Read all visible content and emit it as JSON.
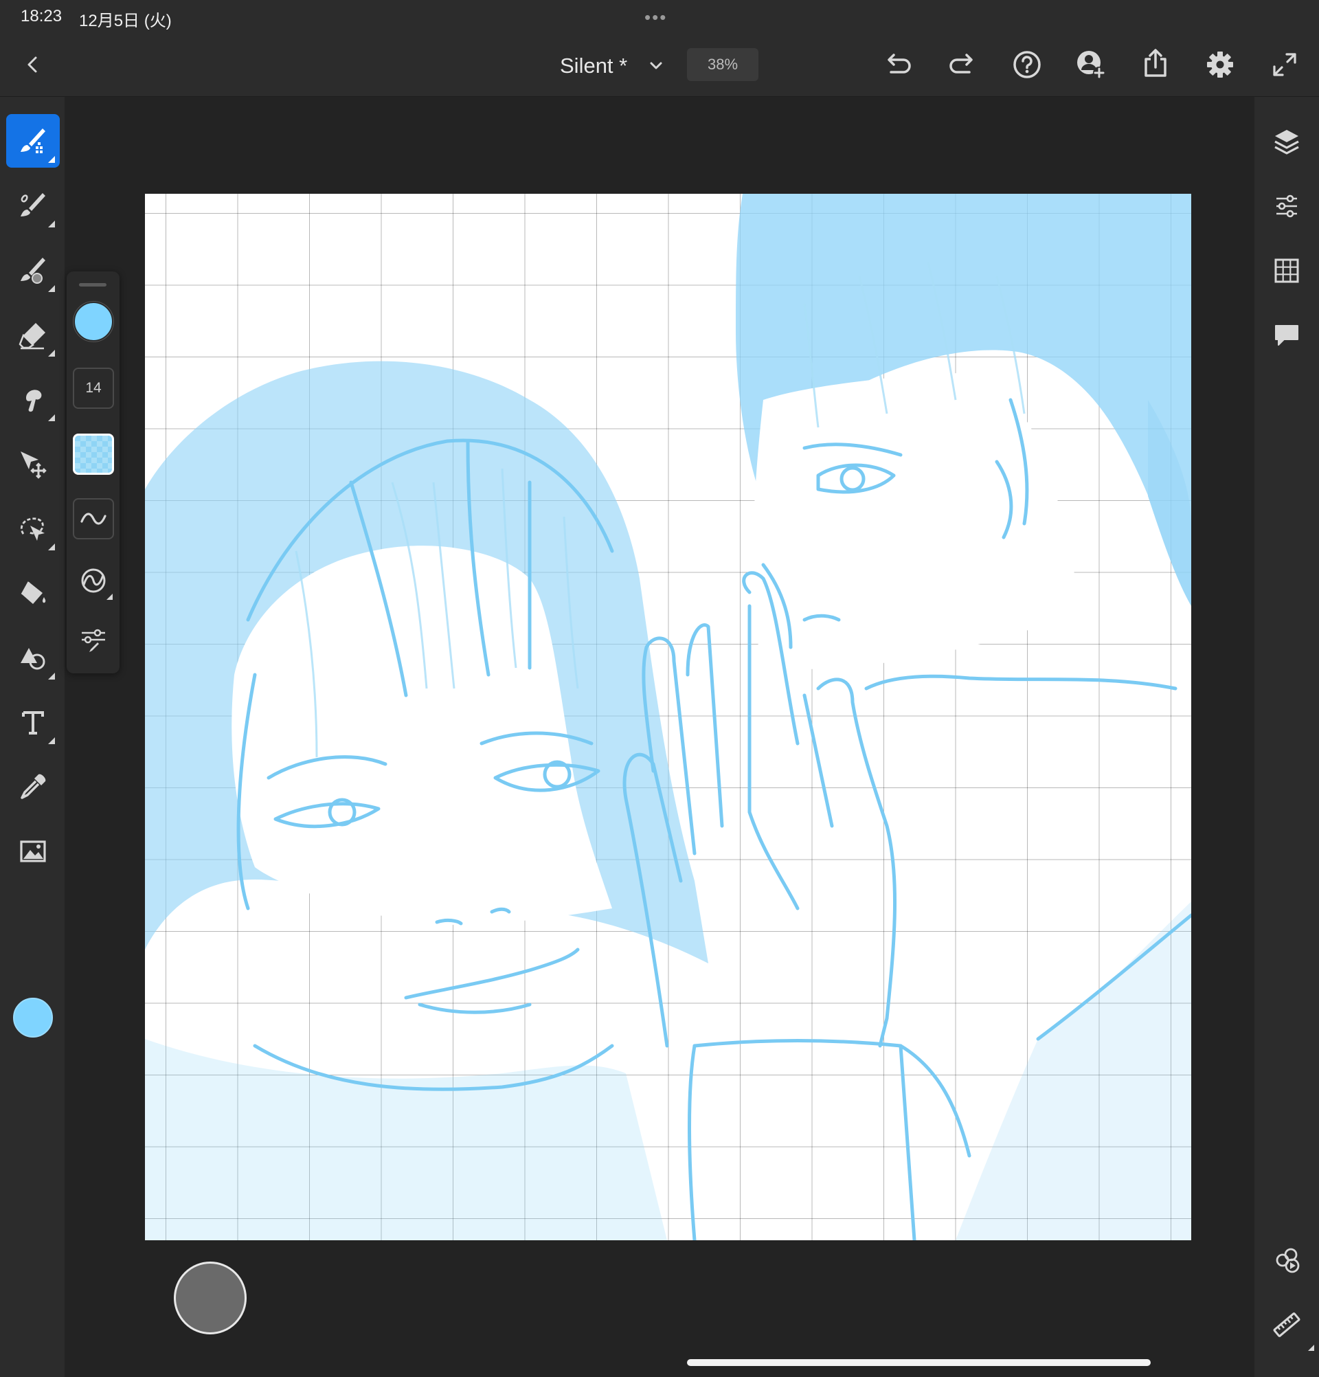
{
  "status_bar": {
    "time": "18:23",
    "date": "12月5日 (火)",
    "dots": "•••"
  },
  "top_bar": {
    "document_title": "Silent *",
    "zoom": "38%",
    "icons": [
      "back-icon",
      "chevron-down-icon",
      "undo-icon",
      "redo-icon",
      "help-icon",
      "invite-icon",
      "share-icon",
      "settings-icon",
      "fullscreen-icon"
    ]
  },
  "left_toolbar": {
    "active_tool": "pixel-brush",
    "tools": [
      "pixel-brush",
      "live-brush",
      "mixer-brush",
      "eraser",
      "smudge",
      "transform",
      "selection",
      "fill",
      "shape",
      "text",
      "eyedropper",
      "image-place"
    ],
    "current_color": "#7fd4ff"
  },
  "brush_panel": {
    "color": "#7fd4ff",
    "size": "14",
    "opacity_swatch": "checker",
    "icons": [
      "smoothing-icon",
      "predictive-stroke-icon",
      "brush-settings-icon"
    ]
  },
  "right_toolbar": {
    "icons": [
      "layers-icon",
      "properties-icon",
      "grid-icon",
      "comments-icon",
      "history-icon",
      "ruler-icon"
    ]
  },
  "canvas": {
    "background": "#ffffff",
    "ink_color": "#8fd3f7",
    "grid": "on"
  },
  "color_puck": "#6a6a6a"
}
